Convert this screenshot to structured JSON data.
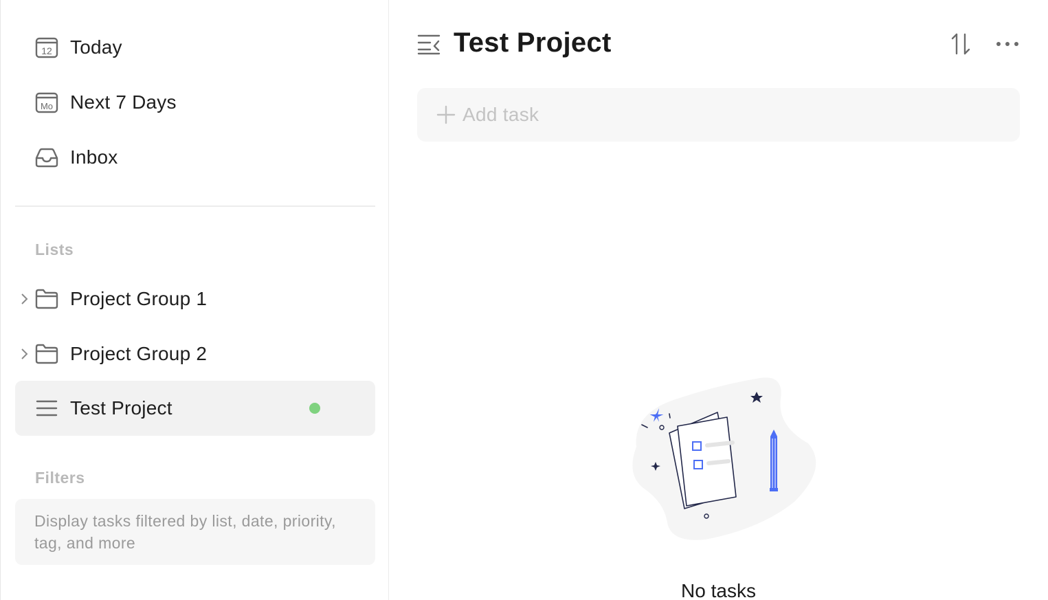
{
  "sidebar": {
    "smart_lists": [
      {
        "label": "Today",
        "icon": "calendar-today-icon",
        "icon_text": "12"
      },
      {
        "label": "Next 7 Days",
        "icon": "calendar-week-icon",
        "icon_text": "Mo"
      },
      {
        "label": "Inbox",
        "icon": "inbox-icon"
      }
    ],
    "lists_title": "Lists",
    "lists": [
      {
        "label": "Project Group 1",
        "icon": "folder-icon",
        "expandable": true
      },
      {
        "label": "Project Group 2",
        "icon": "folder-icon",
        "expandable": true
      },
      {
        "label": "Test Project",
        "icon": "list-icon",
        "active": true,
        "color": "#7fd27f"
      }
    ],
    "filters_title": "Filters",
    "filters_description": "Display tasks filtered by list, date, priority, tag, and more"
  },
  "main": {
    "title": "Test Project",
    "add_task_placeholder": "Add task",
    "empty_state": "No tasks"
  },
  "colors": {
    "accent": "#4c6ef5",
    "list_dot": "#7fd27f",
    "active_bg": "#f2f2f2"
  }
}
